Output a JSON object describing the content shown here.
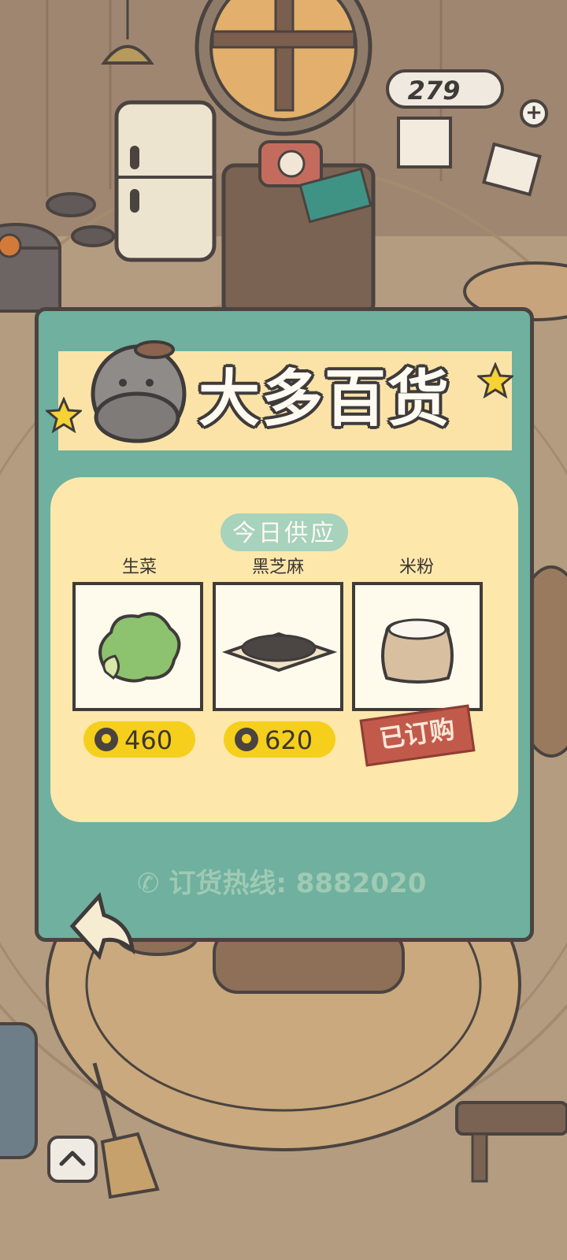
{
  "hud": {
    "currency_count": "279",
    "plus_label": "+"
  },
  "shop": {
    "title": "大多百货",
    "today_label": "今日供应",
    "items": [
      {
        "name": "生菜",
        "price": "460",
        "icon": "lettuce-icon",
        "status": "available"
      },
      {
        "name": "黑芝麻",
        "price": "620",
        "icon": "black-sesame-icon",
        "status": "available"
      },
      {
        "name": "米粉",
        "price": "",
        "icon": "rice-flour-icon",
        "status": "ordered"
      }
    ],
    "ordered_label": "已订购",
    "hotline": "订货热线: 8882020"
  },
  "colors": {
    "panel": "#6fb09f",
    "cream": "#fde7ab",
    "price_pill": "#f5cf1b",
    "ordered_stamp": "#c25a4c",
    "outline": "#4a4340"
  },
  "icons": [
    "phone-icon",
    "back-arrow-icon",
    "up-arrow-icon",
    "coin-icon",
    "hippo-mascot-icon",
    "star-icon"
  ]
}
